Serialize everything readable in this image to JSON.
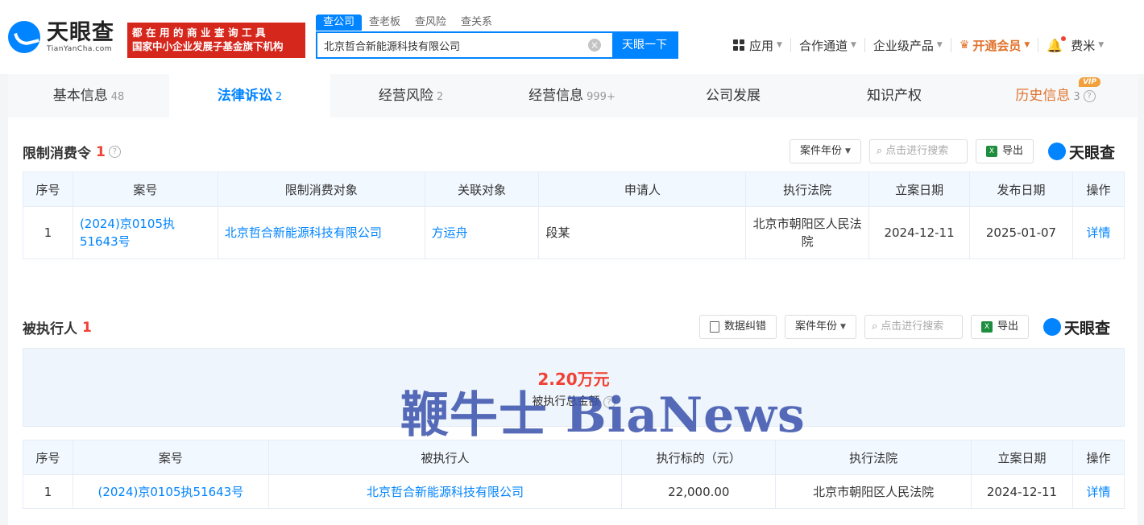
{
  "header": {
    "logo_cn": "天眼查",
    "logo_en": "TianYanCha.com",
    "slogan_line1": "都在用的商业查询工具",
    "slogan_line2": "国家中小企业发展子基金旗下机构",
    "search_tabs": [
      "查公司",
      "查老板",
      "查风险",
      "查关系"
    ],
    "search_value": "北京哲合新能源科技有限公司",
    "search_button": "天眼一下",
    "nav": {
      "apps": "应用",
      "channel": "合作通道",
      "enterprise": "企业级产品",
      "vip": "开通会员",
      "user": "费米"
    }
  },
  "tabs": [
    {
      "label": "基本信息",
      "count": "48"
    },
    {
      "label": "法律诉讼",
      "count": "2"
    },
    {
      "label": "经营风险",
      "count": "2"
    },
    {
      "label": "经营信息",
      "count": "999+"
    },
    {
      "label": "公司发展",
      "count": ""
    },
    {
      "label": "知识产权",
      "count": ""
    },
    {
      "label": "历史信息",
      "count": "3",
      "badge": "VIP"
    }
  ],
  "restriction": {
    "title": "限制消费令",
    "count": "1",
    "toolbar": {
      "year": "案件年份",
      "search": "点击进行搜索",
      "export": "导出",
      "brand": "天眼查"
    },
    "columns": [
      "序号",
      "案号",
      "限制消费对象",
      "关联对象",
      "申请人",
      "执行法院",
      "立案日期",
      "发布日期",
      "操作"
    ],
    "rows": [
      {
        "no": "1",
        "case": "(2024)京0105执51643号",
        "target": "北京哲合新能源科技有限公司",
        "related": "方运舟",
        "applicant": "段某",
        "court": "北京市朝阳区人民法院",
        "filed": "2024-12-11",
        "published": "2025-01-07",
        "action": "详情"
      }
    ]
  },
  "executed": {
    "title": "被执行人",
    "count": "1",
    "toolbar": {
      "correction": "数据纠错",
      "year": "案件年份",
      "search": "点击进行搜索",
      "export": "导出",
      "brand": "天眼查"
    },
    "amount": "2.20万元",
    "amount_label": "被执行总金额",
    "columns": [
      "序号",
      "案号",
      "被执行人",
      "执行标的（元）",
      "执行法院",
      "立案日期",
      "操作"
    ],
    "rows": [
      {
        "no": "1",
        "case": "(2024)京0105执51643号",
        "name": "北京哲合新能源科技有限公司",
        "target_amount": "22,000.00",
        "court": "北京市朝阳区人民法院",
        "filed": "2024-12-11",
        "action": "详情"
      }
    ]
  },
  "watermark": "鞭牛士 BiaNews",
  "colors": {
    "brand": "#0084ff",
    "alert": "#f04134",
    "vip": "#e0732c",
    "slogan_bg": "#d6271d"
  }
}
